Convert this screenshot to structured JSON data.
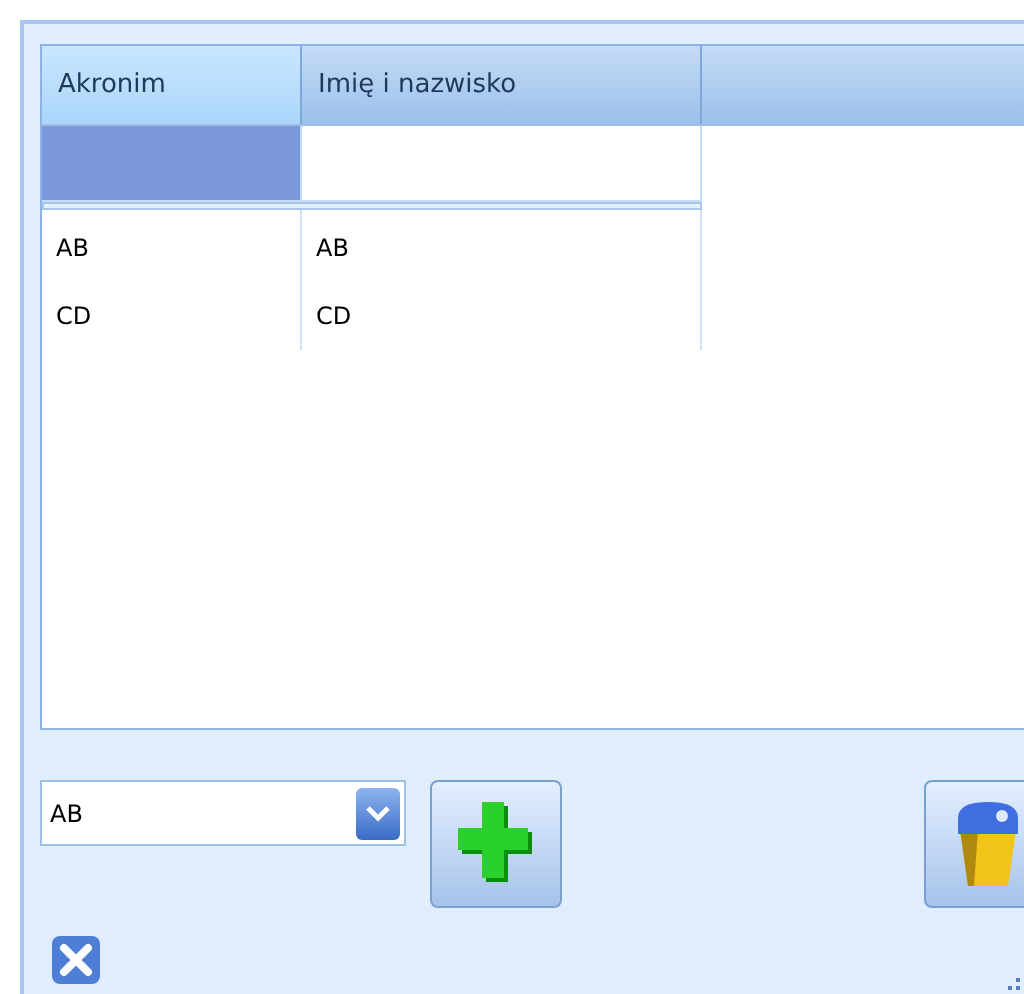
{
  "table": {
    "columns": [
      {
        "label": "Akronim"
      },
      {
        "label": "Imię i nazwisko"
      }
    ],
    "filter_row": [
      {
        "selected": true
      },
      {
        "selected": false
      }
    ],
    "rows": [
      [
        "AB",
        "AB"
      ],
      [
        "CD",
        "CD"
      ]
    ]
  },
  "combo": {
    "value": "AB"
  },
  "buttons": [
    {
      "kind": "add"
    },
    {
      "kind": "delete"
    }
  ]
}
